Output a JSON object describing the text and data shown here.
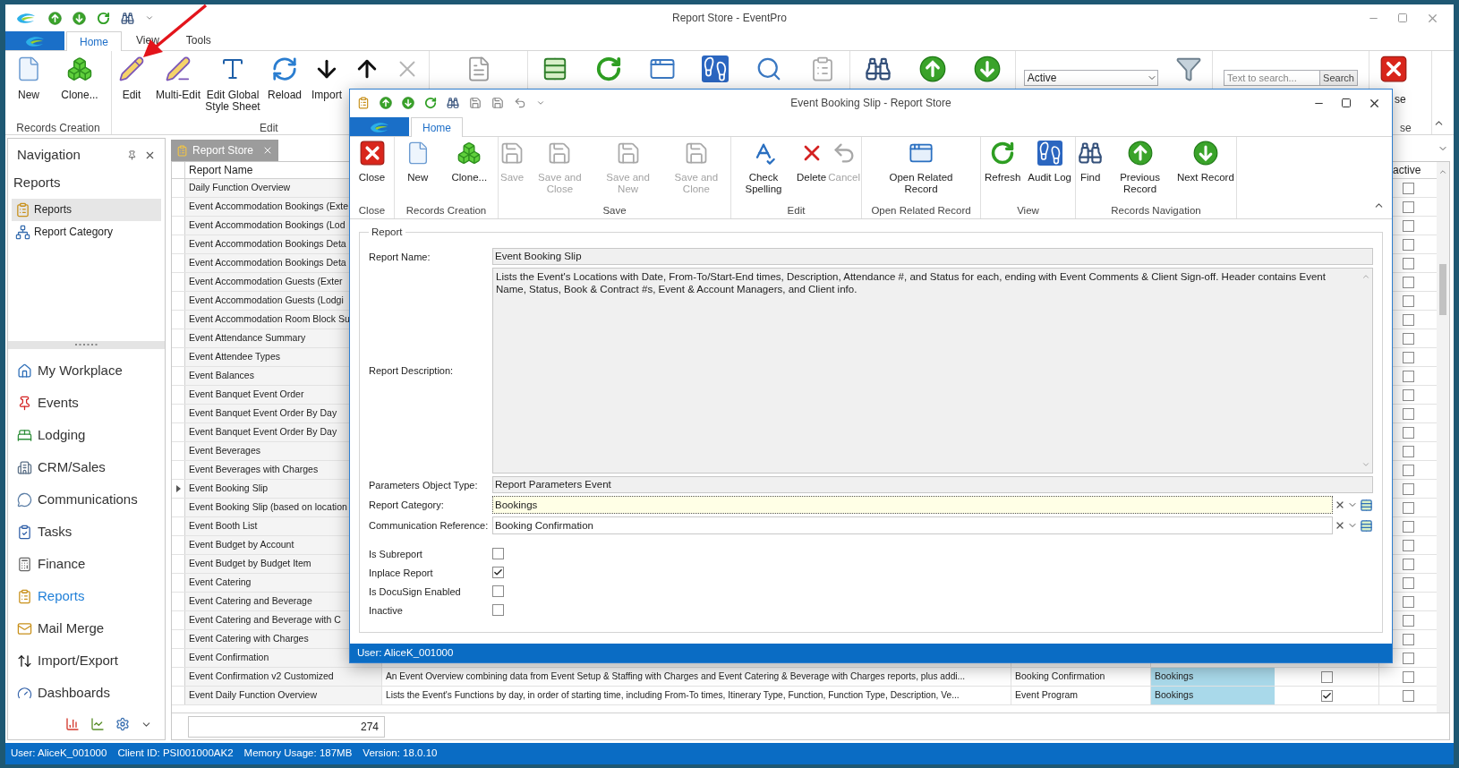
{
  "window": {
    "title": "Report Store - EventPro"
  },
  "ribbon_tabs": [
    {
      "label": "Home",
      "selected": true
    },
    {
      "label": "View",
      "selected": false
    },
    {
      "label": "Tools",
      "selected": false
    }
  ],
  "ribbon_groups": [
    {
      "label": "Records Creation",
      "buttons": [
        {
          "kind": "new",
          "label": "New"
        },
        {
          "kind": "clone",
          "label": "Clone..."
        }
      ]
    },
    {
      "label": "Edit",
      "buttons": [
        {
          "kind": "edit",
          "label": "Edit"
        },
        {
          "kind": "multiedit",
          "label": "Multi-Edit"
        },
        {
          "kind": "style",
          "label": "Edit Global Style Sheet"
        },
        {
          "kind": "reload",
          "label": "Reload"
        },
        {
          "kind": "import",
          "label": "Import"
        },
        {
          "kind": "export"
        },
        {
          "kind": "remove"
        }
      ]
    },
    {
      "buttons": [
        {
          "kind": "report"
        }
      ]
    },
    {
      "buttons": [
        {
          "kind": "grid"
        },
        {
          "kind": "refresh"
        },
        {
          "kind": "window"
        },
        {
          "kind": "audit"
        },
        {
          "kind": "preview"
        },
        {
          "kind": "clipboard"
        }
      ]
    },
    {
      "buttons": [
        {
          "kind": "find"
        },
        {
          "kind": "previous"
        },
        {
          "kind": "next"
        }
      ]
    },
    {
      "filter": {
        "value": "Active"
      },
      "buttons": [
        {
          "kind": "filter"
        }
      ]
    },
    {
      "search": {
        "placeholder": "Text to search...",
        "button": "Search"
      }
    },
    {
      "label": "se",
      "buttons": [
        {
          "kind": "close",
          "label": "se"
        }
      ]
    }
  ],
  "navigation": {
    "title": "Navigation",
    "section": "Reports",
    "items": [
      {
        "label": "Reports",
        "kind": "reports",
        "selected": true
      },
      {
        "label": "Report Category",
        "kind": "category",
        "selected": false
      }
    ],
    "modules": [
      {
        "label": "My Workplace",
        "kind": "workplace",
        "selected": false
      },
      {
        "label": "Events",
        "kind": "events",
        "selected": false
      },
      {
        "label": "Lodging",
        "kind": "lodging",
        "selected": false
      },
      {
        "label": "CRM/Sales",
        "kind": "crm",
        "selected": false
      },
      {
        "label": "Communications",
        "kind": "communications",
        "selected": false
      },
      {
        "label": "Tasks",
        "kind": "tasks",
        "selected": false
      },
      {
        "label": "Finance",
        "kind": "finance",
        "selected": false
      },
      {
        "label": "Reports",
        "kind": "reports",
        "selected": true
      },
      {
        "label": "Mail Merge",
        "kind": "mailmerge",
        "selected": false
      },
      {
        "label": "Import/Export",
        "kind": "importexport",
        "selected": false
      },
      {
        "label": "Dashboards",
        "kind": "dashboards",
        "selected": false
      }
    ]
  },
  "document_tab": {
    "label": "Report Store"
  },
  "grid": {
    "columns": {
      "report_name": "Report Name",
      "active": "active"
    },
    "rows": [
      {
        "name": "Daily Function Overview",
        "selected": false,
        "active": false
      },
      {
        "name": "Event Accommodation Bookings (Exte",
        "selected": false,
        "active": false
      },
      {
        "name": "Event Accommodation Bookings (Lod",
        "selected": false,
        "active": false
      },
      {
        "name": "Event Accommodation Bookings Deta",
        "selected": false,
        "active": false
      },
      {
        "name": "Event Accommodation Bookings Deta",
        "selected": false,
        "active": false
      },
      {
        "name": "Event Accommodation Guests (Exter",
        "selected": false,
        "active": false
      },
      {
        "name": "Event Accommodation Guests (Lodgi",
        "selected": false,
        "active": false
      },
      {
        "name": "Event Accommodation Room Block Su",
        "selected": false,
        "active": false
      },
      {
        "name": "Event Attendance Summary",
        "selected": false,
        "active": false
      },
      {
        "name": "Event Attendee Types",
        "selected": false,
        "active": false
      },
      {
        "name": "Event Balances",
        "selected": false,
        "active": false
      },
      {
        "name": "Event Banquet Event Order",
        "selected": false,
        "active": false
      },
      {
        "name": "Event Banquet Event Order By Day",
        "selected": false,
        "active": false
      },
      {
        "name": "Event Banquet Event Order By Day",
        "selected": false,
        "active": false
      },
      {
        "name": "Event Beverages",
        "selected": false,
        "active": false
      },
      {
        "name": "Event Beverages with Charges",
        "selected": false,
        "active": false
      },
      {
        "name": "Event Booking Slip",
        "selected": true,
        "active": false
      },
      {
        "name": "Event Booking Slip (based on location",
        "selected": false,
        "active": false
      },
      {
        "name": "Event Booth List",
        "selected": false,
        "active": false
      },
      {
        "name": "Event Budget by Account",
        "selected": false,
        "active": false
      },
      {
        "name": "Event Budget by Budget Item",
        "selected": false,
        "active": false
      },
      {
        "name": "Event Catering",
        "selected": false,
        "active": false
      },
      {
        "name": "Event Catering and Beverage",
        "selected": false,
        "active": false
      },
      {
        "name": "Event Catering and Beverage with C",
        "selected": false,
        "active": false
      },
      {
        "name": "Event Catering with Charges",
        "selected": false,
        "active": false
      },
      {
        "name": "Event Confirmation",
        "selected": false,
        "active": false
      },
      {
        "name": "Event Confirmation v2 Customized",
        "description": "An Event Overview combining data from Event Setup & Staffing with Charges and Event Catering & Beverage with Charges reports, plus addi...",
        "communication": "Booking Confirmation",
        "category": "Bookings",
        "column_5": false,
        "selected": false,
        "active": false
      },
      {
        "name": "Event Daily Function Overview",
        "description": "Lists the Event's Functions by day, in order of starting time, including From-To times, Itinerary Type, Function, Function Type, Description, Ve...",
        "communication": "Event Program",
        "category": "Bookings",
        "column_5": true,
        "selected": false,
        "active": false
      }
    ],
    "total": "274"
  },
  "status_bar": [
    "User: AliceK_001000",
    "Client ID: PSI001000AK2",
    "Memory Usage: 187MB",
    "Version: 18.0.10"
  ],
  "dialog": {
    "title": "Event Booking Slip - Report Store",
    "tabs": [
      {
        "label": "Home",
        "selected": true
      }
    ],
    "ribbon_groups": [
      {
        "label": "Close",
        "buttons": [
          {
            "kind": "close",
            "label": "Close",
            "disabled": false
          }
        ]
      },
      {
        "label": "Records Creation",
        "buttons": [
          {
            "kind": "new",
            "label": "New",
            "disabled": false
          },
          {
            "kind": "clone",
            "label": "Clone...",
            "disabled": false
          }
        ]
      },
      {
        "label": "Save",
        "buttons": [
          {
            "kind": "save",
            "label": "Save",
            "disabled": true
          },
          {
            "kind": "saveclose",
            "label": "Save and Close",
            "disabled": true
          },
          {
            "kind": "savenew",
            "label": "Save and New",
            "disabled": true
          },
          {
            "kind": "saveclone",
            "label": "Save and Clone",
            "disabled": true
          }
        ]
      },
      {
        "label": "Edit",
        "buttons": [
          {
            "kind": "spelling",
            "label": "Check Spelling",
            "disabled": false
          },
          {
            "kind": "delete",
            "label": "Delete",
            "disabled": false
          },
          {
            "kind": "cancel",
            "label": "Cancel",
            "disabled": true
          }
        ]
      },
      {
        "label": "Open Related Record",
        "buttons": [
          {
            "kind": "related",
            "label": "Open Related Record",
            "disabled": false
          }
        ]
      },
      {
        "label": "View",
        "buttons": [
          {
            "kind": "refresh",
            "label": "Refresh",
            "disabled": false
          },
          {
            "kind": "audit",
            "label": "Audit Log",
            "disabled": false
          }
        ]
      },
      {
        "label": "Records Navigation",
        "buttons": [
          {
            "kind": "find",
            "label": "Find",
            "disabled": false
          },
          {
            "kind": "previous",
            "label": "Previous Record",
            "disabled": false
          },
          {
            "kind": "next",
            "label": "Next Record",
            "disabled": false
          }
        ]
      }
    ],
    "group_title": "Report",
    "fields": [
      {
        "kind": "text",
        "label": "Report Name:",
        "value": "Event Booking Slip",
        "readonly": true,
        "focused": false
      },
      {
        "kind": "memo",
        "label": "Report Description:",
        "value": "Lists the Event's Locations with Date, From-To/Start-End times, Description, Attendance #, and Status for each, ending with Event Comments & Client Sign-off. Header contains Event Name, Status, Book & Contract #s, Event & Account Managers, and Client info.",
        "readonly": true,
        "focused": false
      },
      {
        "kind": "text",
        "label": "Parameters Object Type:",
        "value": "Report Parameters Event",
        "readonly": true,
        "focused": false
      },
      {
        "kind": "lookup",
        "label": "Report Category:",
        "value": "Bookings",
        "readonly": false,
        "focused": true
      },
      {
        "kind": "lookup",
        "label": "Communication Reference:",
        "value": "Booking Confirmation",
        "readonly": false,
        "focused": false
      }
    ],
    "checkboxes": [
      {
        "label": "Is Subreport",
        "checked": false
      },
      {
        "label": "Inplace Report",
        "checked": true
      },
      {
        "label": "Is DocuSign Enabled",
        "checked": false
      },
      {
        "label": "Inactive",
        "checked": false
      }
    ],
    "status": "User: AliceK_001000"
  }
}
